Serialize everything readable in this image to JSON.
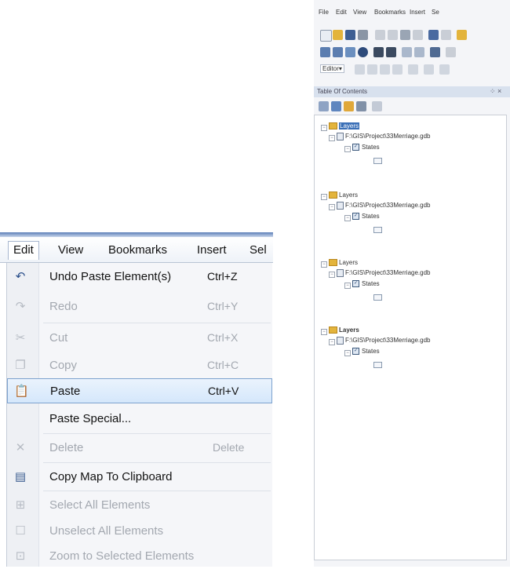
{
  "edit_menu": {
    "menubar": [
      "Edit",
      "View",
      "Bookmarks",
      "Insert",
      "Sel"
    ],
    "items": [
      {
        "icon": "undo-icon",
        "glyph": "↶",
        "label": "Undo Paste Element(s)",
        "shortcut": "Ctrl+Z",
        "enabled": true
      },
      {
        "icon": "redo-icon",
        "glyph": "↷",
        "label": "Redo",
        "shortcut": "Ctrl+Y",
        "enabled": false
      },
      {
        "icon": "cut-icon",
        "glyph": "✂",
        "label": "Cut",
        "shortcut": "Ctrl+X",
        "enabled": false
      },
      {
        "icon": "copy-icon",
        "glyph": "❐",
        "label": "Copy",
        "shortcut": "Ctrl+C",
        "enabled": false
      },
      {
        "icon": "paste-icon",
        "glyph": "📋",
        "label": "Paste",
        "shortcut": "Ctrl+V",
        "enabled": true,
        "highlighted": true
      },
      {
        "icon": "",
        "glyph": "",
        "label": "Paste Special...",
        "shortcut": "",
        "enabled": true
      },
      {
        "icon": "delete-icon",
        "glyph": "✕",
        "label": "Delete",
        "shortcut": "Delete",
        "enabled": false
      },
      {
        "icon": "copy-map-icon",
        "glyph": "▤",
        "label": "Copy Map To Clipboard",
        "shortcut": "",
        "enabled": true
      },
      {
        "icon": "select-all-icon",
        "glyph": "⊞",
        "label": "Select All Elements",
        "shortcut": "",
        "enabled": false
      },
      {
        "icon": "unselect-all-icon",
        "glyph": "☐",
        "label": "Unselect All Elements",
        "shortcut": "",
        "enabled": false
      },
      {
        "icon": "zoom-selected-icon",
        "glyph": "⊡",
        "label": "Zoom to Selected Elements",
        "shortcut": "",
        "enabled": false
      }
    ]
  },
  "arcmap": {
    "menubar": [
      "File",
      "Edit",
      "View",
      "Bookmarks",
      "Insert",
      "Se"
    ],
    "editor_label": "Editor▾",
    "toc_title": "Table Of Contents",
    "toc_close": "⁘ ×",
    "data_frames": [
      {
        "name": "Layers",
        "selected": true,
        "gdb": "F:\\GIS\\Project\\33Merriage.gdb",
        "layer": "States"
      },
      {
        "name": "Layers",
        "selected": false,
        "gdb": "F:\\GIS\\Project\\33Merriage.gdb",
        "layer": "States"
      },
      {
        "name": "Layers",
        "selected": false,
        "gdb": "F:\\GIS\\Project\\33Merriage.gdb",
        "layer": "States"
      },
      {
        "name": "Layers",
        "selected": false,
        "gdb": "F:\\GIS\\Project\\33Merriage.gdb",
        "layer": "States"
      }
    ]
  },
  "colors": {
    "highlight_border": "#7da2ce",
    "selection_blue": "#3a6fb7",
    "layer_folder": "#e3b43c"
  }
}
